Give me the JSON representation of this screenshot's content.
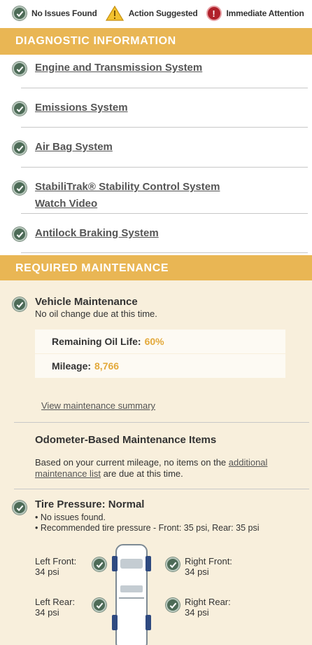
{
  "legend": {
    "no_issues": "No Issues Found",
    "action": "Action Suggested",
    "immediate": "Immediate Attention",
    "immediate_glyph": "!"
  },
  "diagnostic": {
    "header": "DIAGNOSTIC INFORMATION",
    "items": [
      {
        "label": "Engine and Transmission System"
      },
      {
        "label": "Emissions System"
      },
      {
        "label": "Air Bag System"
      },
      {
        "label": "StabiliTrak® Stability Control System",
        "sub": "Watch Video"
      },
      {
        "label": "Antilock Braking System"
      }
    ]
  },
  "maintenance": {
    "header": "REQUIRED MAINTENANCE",
    "vehicle_title": "Vehicle Maintenance",
    "vehicle_sub": "No oil change due at this time.",
    "oil_label": "Remaining Oil Life:",
    "oil_value": "60%",
    "mileage_label": "Mileage:",
    "mileage_value": "8,766",
    "summary_link": "View maintenance summary",
    "odometer_title": "Odometer-Based Maintenance Items",
    "odometer_text_1": "Based on your current mileage, no items on the ",
    "odometer_link": "additional maintenance list",
    "odometer_text_2": " are due at this time."
  },
  "tire": {
    "title": "Tire Pressure: Normal",
    "bullet_1": "• No issues found.",
    "bullet_2": "• Recommended tire pressure - Front: 35 psi, Rear: 35 psi",
    "left_front_label": "Left Front:",
    "left_front_value": "34 psi",
    "right_front_label": "Right Front:",
    "right_front_value": "34 psi",
    "left_rear_label": "Left Rear:",
    "left_rear_value": "34 psi",
    "right_rear_label": "Right Rear:",
    "right_rear_value": "34 psi"
  },
  "colors": {
    "header": "#e9b654",
    "maintenance_bg": "#f8efdc",
    "check": "#4d6b57",
    "highlight": "#e3a93a",
    "alert": "#b0202a"
  }
}
